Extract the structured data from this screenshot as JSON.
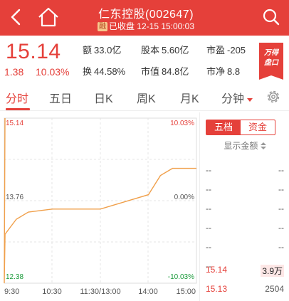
{
  "header": {
    "title": "仁东控股(002647)",
    "badge": "融",
    "status": "已收盘",
    "datetime": "12-15 15:00:03"
  },
  "quote": {
    "price": "15.14",
    "change": "1.38",
    "change_pct": "10.03%",
    "stats": [
      {
        "label": "额",
        "value": "33.0亿"
      },
      {
        "label": "股本",
        "value": "5.60亿"
      },
      {
        "label": "市盈",
        "value": "-205"
      },
      {
        "label": "换",
        "value": "44.58%"
      },
      {
        "label": "市值",
        "value": "84.8亿"
      },
      {
        "label": "市净",
        "value": "8.8"
      }
    ],
    "wan_badge_line1": "万得",
    "wan_badge_line2": "盘口"
  },
  "tabs": [
    {
      "label": "分时",
      "active": true
    },
    {
      "label": "五日",
      "active": false
    },
    {
      "label": "日K",
      "active": false
    },
    {
      "label": "周K",
      "active": false
    },
    {
      "label": "月K",
      "active": false
    },
    {
      "label": "分钟",
      "active": false
    }
  ],
  "chart_labels": {
    "top_left": "15.14",
    "top_right": "10.03%",
    "mid_left": "13.76",
    "mid_right": "0.00%",
    "bottom_left": "12.38",
    "bottom_right": "-10.03%",
    "x_ticks": [
      "9:30",
      "10:30",
      "11:30/13:00",
      "14:00",
      "15:00"
    ]
  },
  "chart_data": {
    "type": "line",
    "x": [
      "9:30",
      "9:31",
      "9:45",
      "10:00",
      "10:30",
      "11:00",
      "11:30/13:00",
      "13:30",
      "14:00",
      "14:15",
      "14:30",
      "15:00"
    ],
    "series": [
      {
        "values": [
          12.38,
          13.2,
          13.45,
          13.57,
          13.62,
          13.62,
          13.62,
          13.74,
          13.86,
          14.18,
          14.3,
          14.3
        ]
      }
    ],
    "ylim": [
      12.38,
      15.14
    ]
  },
  "side": {
    "seg_active": "五档",
    "seg_inactive": "资金",
    "amount_toggle": "显示金额",
    "order_book": [
      {
        "price": "--",
        "volume": "--"
      },
      {
        "price": "--",
        "volume": "--"
      },
      {
        "price": "--",
        "volume": "--"
      },
      {
        "price": "--",
        "volume": "--"
      },
      {
        "price": "--",
        "volume": "--"
      },
      {
        "price": "--",
        "volume": "--"
      },
      {
        "price": "15.14",
        "volume": "3.9万"
      },
      {
        "price": "15.13",
        "volume": "2504"
      }
    ]
  },
  "colors": {
    "accent": "#e5403a",
    "price_line": "#f0a04b"
  }
}
